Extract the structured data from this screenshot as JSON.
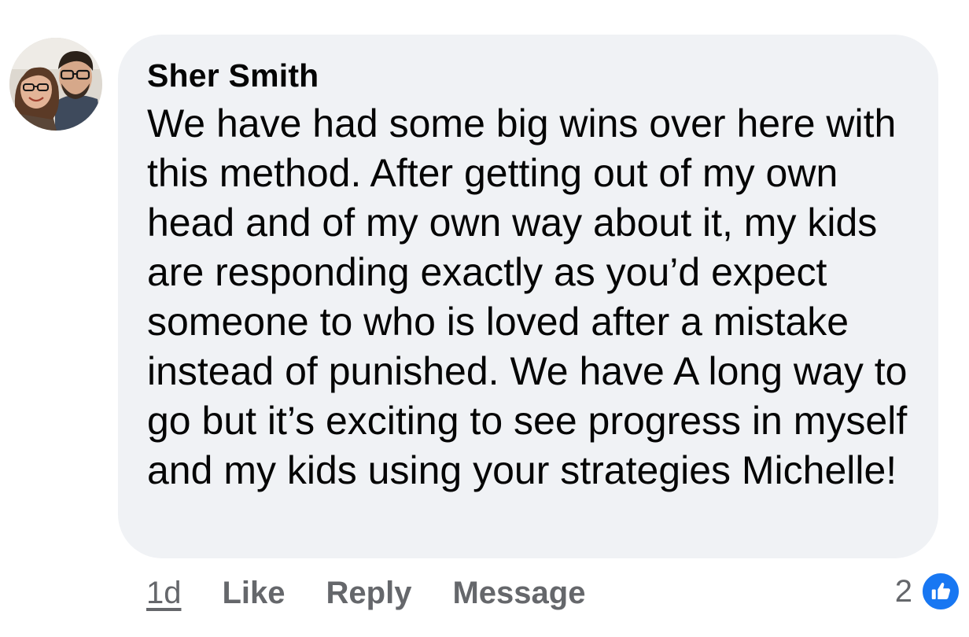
{
  "comment": {
    "author": "Sher Smith",
    "text": "We have had some big wins over here with this method. After getting out of my own head and of my own way about it, my kids are responding exactly as you’d expect someone to who is loved after a mistake instead of punished. We have A long way to go but it’s exciting to see progress in myself and my kids using your strategies Michelle!",
    "avatar_icon": "profile-photo-avatar"
  },
  "actions": {
    "timestamp": "1d",
    "like_label": "Like",
    "reply_label": "Reply",
    "message_label": "Message"
  },
  "reactions": {
    "count": "2",
    "icon": "thumbs-up-icon",
    "badge_color": "#1877f2"
  },
  "colors": {
    "bubble_bg": "#f0f2f5",
    "text": "#050505",
    "secondary_text": "#65676b"
  }
}
